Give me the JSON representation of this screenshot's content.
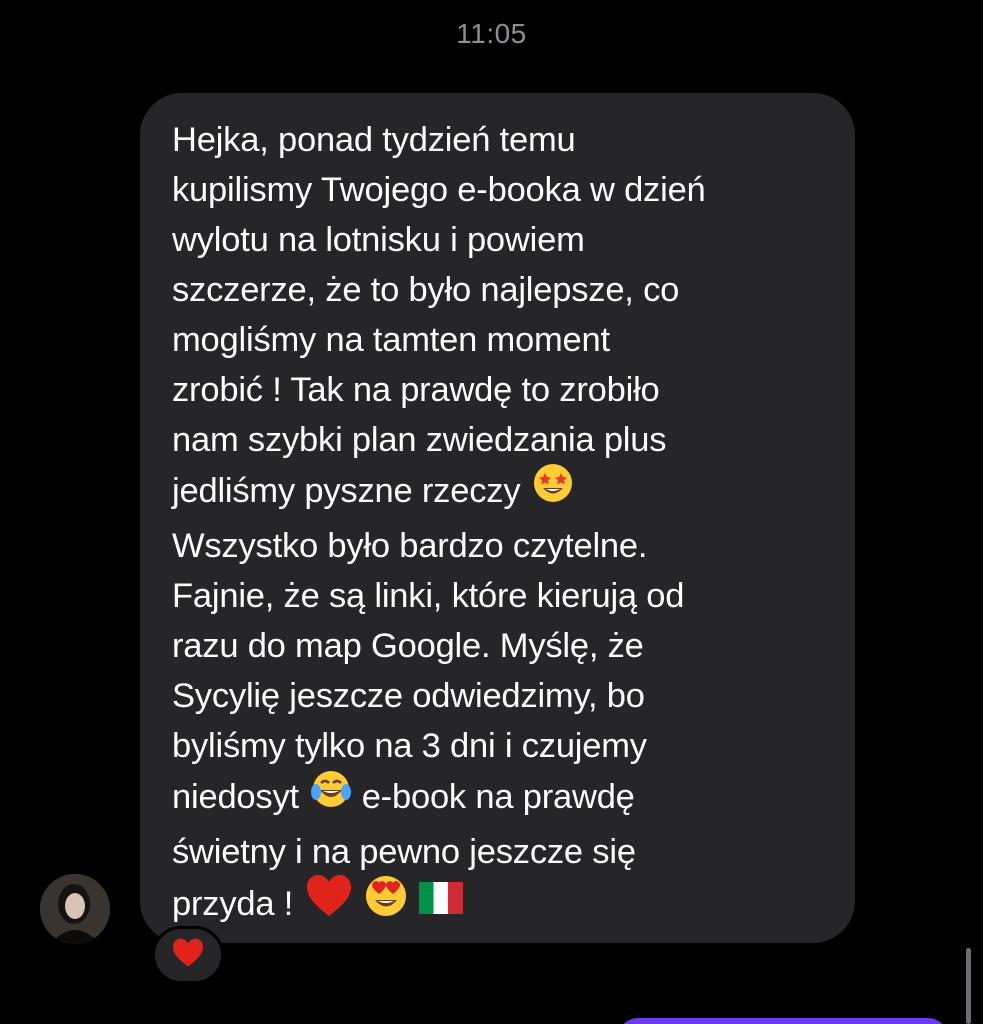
{
  "chat": {
    "timestamp": "11:05",
    "message": {
      "lines": [
        "Hejka, ponad tydzień temu",
        "kupilismy Twojego e-booka w dzień",
        "wylotu na lotnisku i powiem",
        "szczerze, że to było najlepsze, co",
        "mogliśmy na tamten moment",
        "zrobić ! Tak na prawdę to zrobiło",
        "nam szybki plan zwiedzania plus",
        "jedliśmy pyszne rzeczy",
        "Wszystko było bardzo czytelne.",
        "Fajnie, że są linki, które kierują od",
        "razu do map Google. Myślę, że",
        "Sycylię jeszcze odwiedzimy, bo",
        "byliśmy tylko na 3 dni i czujemy",
        "niedosyt",
        "e-book na prawdę",
        "świetny i na pewno jeszcze się",
        "przyda !"
      ],
      "emojis": {
        "star_struck": "star-struck-emoji",
        "tears_of_joy": "tears-of-joy-emoji",
        "red_heart": "red-heart-emoji",
        "heart_eyes": "heart-eyes-emoji",
        "italy_flag": "italy-flag-emoji"
      }
    },
    "reaction": "red-heart-emoji",
    "colors": {
      "background": "#000000",
      "bubble": "#262629",
      "text": "#ffffff",
      "timestamp": "#8e8e93",
      "outgoing_bubble": "#6a3cf0",
      "heart": "#e0241b"
    }
  }
}
